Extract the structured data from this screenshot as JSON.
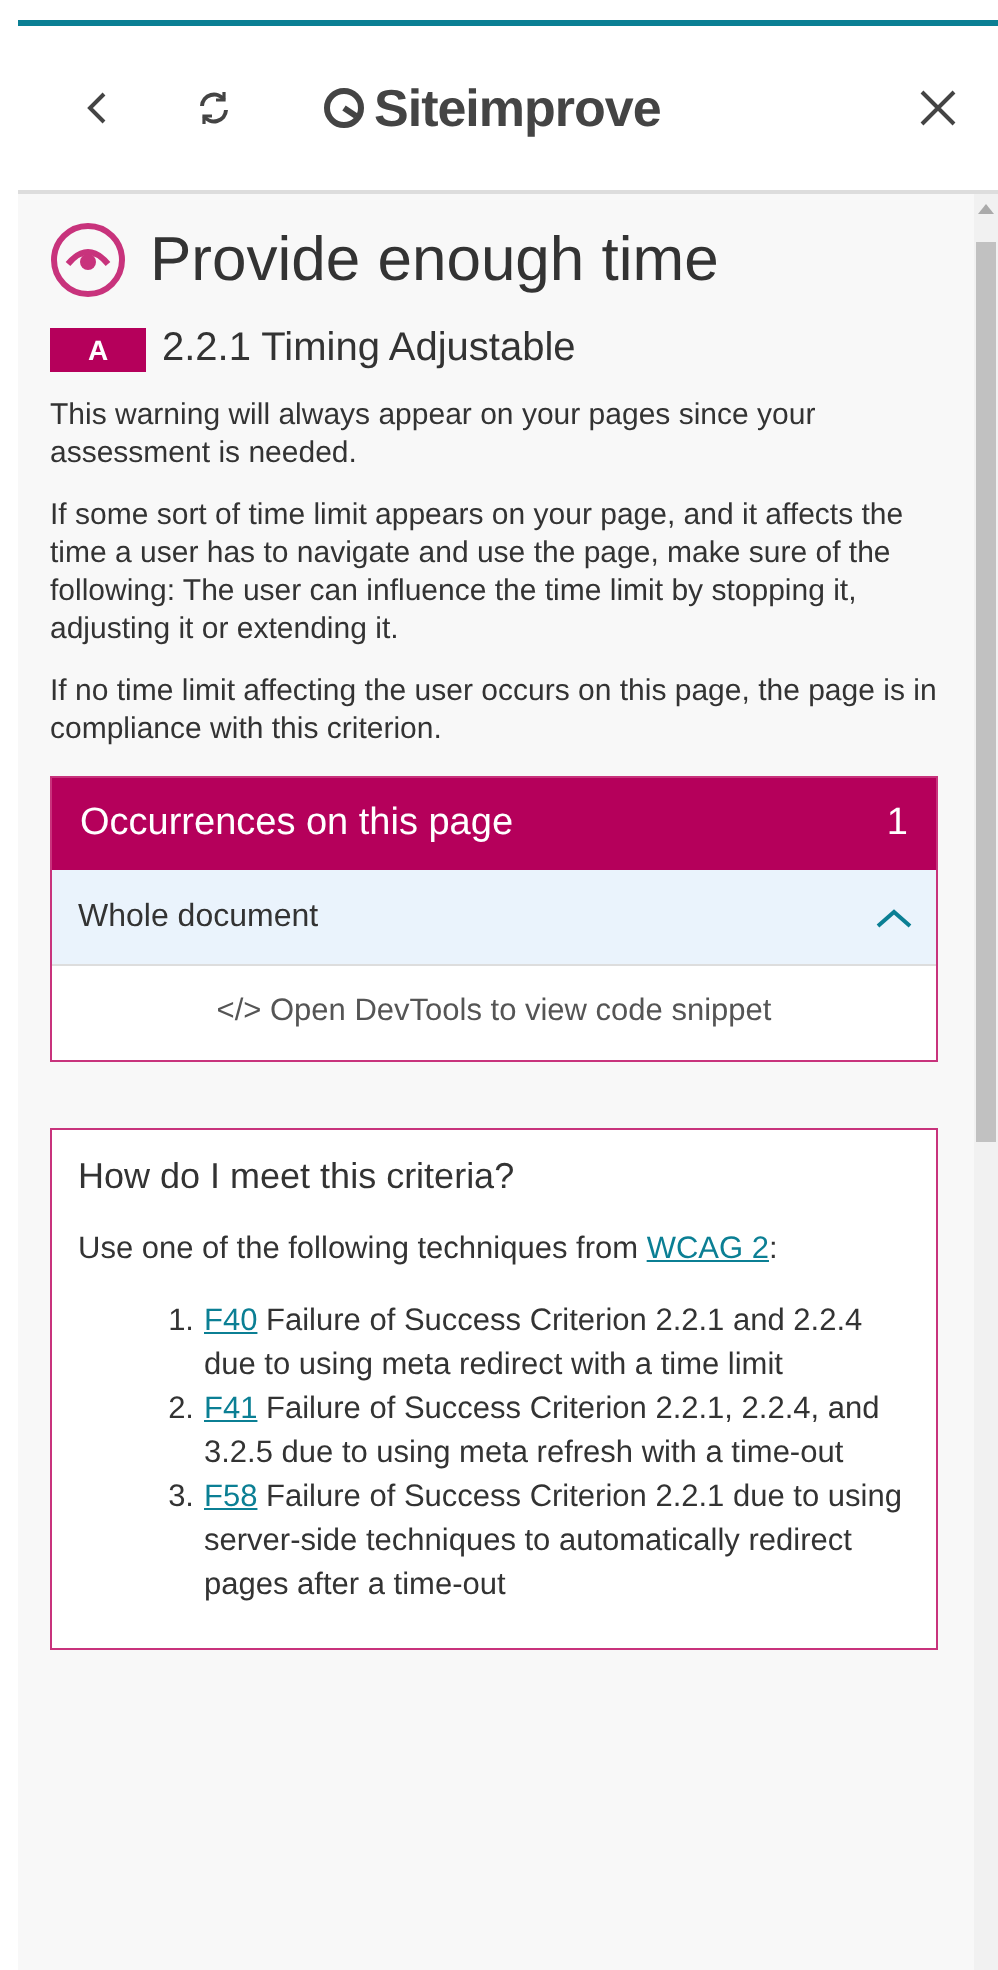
{
  "header": {
    "brand": "Siteimprove"
  },
  "issue": {
    "title": "Provide enough time",
    "level": "A",
    "criterion": "2.2.1 Timing Adjustable",
    "paragraphs": [
      "This warning will always appear on your pages since your assessment is needed.",
      "If some sort of time limit appears on your page, and it affects the time a user has to navigate and use the page, make sure of the following: The user can influence the time limit by stopping it, adjusting it or extending it.",
      "If no time limit affecting the user occurs on this page, the page is in compliance with this criterion."
    ]
  },
  "occurrences": {
    "title": "Occurrences on this page",
    "count": "1",
    "item": {
      "label": "Whole document",
      "expanded": true
    },
    "hint": "</> Open DevTools to view code snippet"
  },
  "criteria": {
    "title": "How do I meet this criteria?",
    "intro": {
      "before": "Use one of the following techniques from ",
      "link": "WCAG 2",
      "after": ":"
    },
    "techniques": [
      {
        "number": "1.",
        "code": "F40",
        "text": " Failure of Success Criterion 2.2.1 and 2.2.4 due to using meta redirect with a time limit"
      },
      {
        "number": "2.",
        "code": "F41",
        "text": " Failure of Success Criterion 2.2.1, 2.2.4, and 3.2.5 due to using meta refresh with a time-out"
      },
      {
        "number": "3.",
        "code": "F58",
        "text": " Failure of Success Criterion 2.2.1 due to using server-side techniques to automatically redirect pages after a time-out"
      }
    ]
  }
}
